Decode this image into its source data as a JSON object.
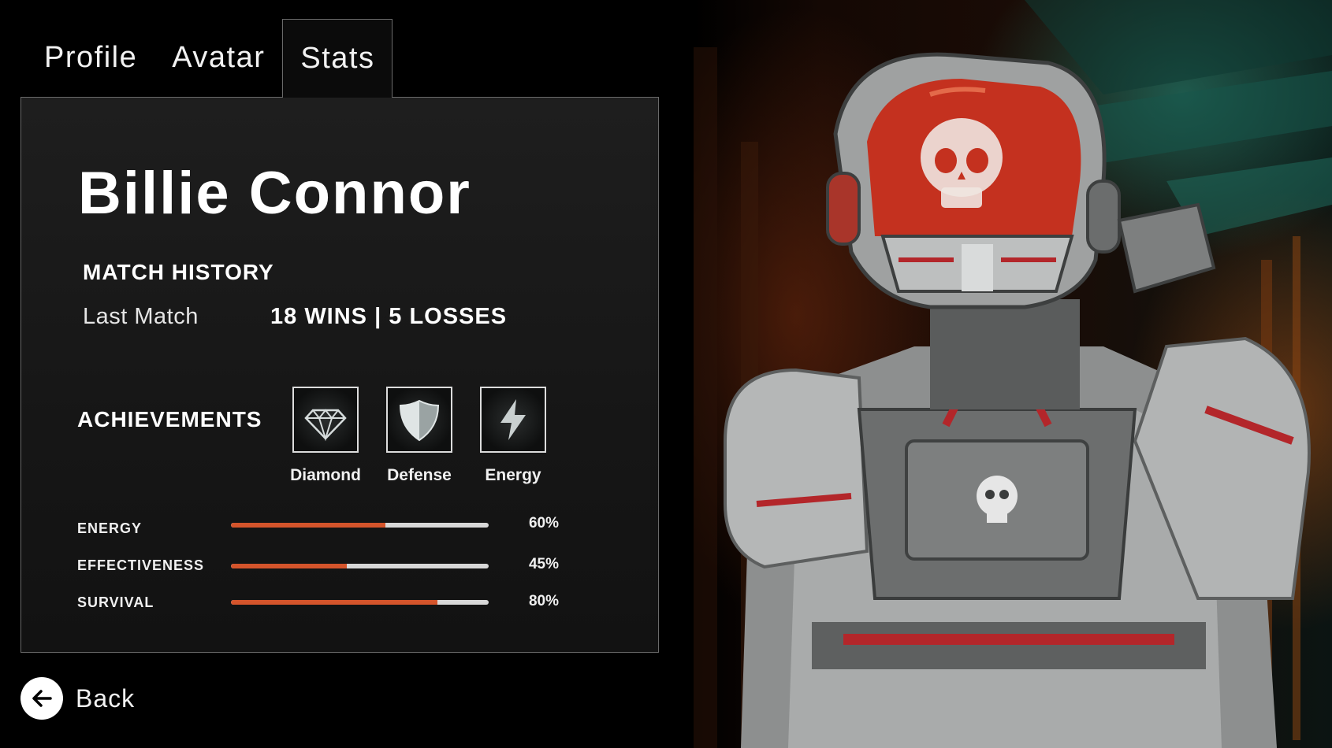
{
  "tabs": [
    {
      "label": "Profile",
      "active": false
    },
    {
      "label": "Avatar",
      "active": false
    },
    {
      "label": "Stats",
      "active": true
    }
  ],
  "player": {
    "name": "Billie Connor"
  },
  "match_history": {
    "title": "MATCH HISTORY",
    "last_match_label": "Last Match",
    "last_match_value": "18 WINS | 5 LOSSES"
  },
  "achievements": {
    "title": "ACHIEVEMENTS",
    "items": [
      {
        "label": "Diamond",
        "icon": "diamond-icon"
      },
      {
        "label": "Defense",
        "icon": "shield-icon"
      },
      {
        "label": "Energy",
        "icon": "lightning-icon"
      }
    ]
  },
  "stats": [
    {
      "label": "ENERGY",
      "value_text": "60%",
      "value": 0.6
    },
    {
      "label": "EFFECTIVENESS",
      "value_text": "45%",
      "value": 0.45
    },
    {
      "label": "SURVIVAL",
      "value_text": "80%",
      "value": 0.8
    }
  ],
  "back": {
    "label": "Back",
    "icon": "arrow-left-icon"
  },
  "colors": {
    "accent": "#d4542b",
    "track": "#d8d8d8",
    "panel_border": "#6a6a6a"
  }
}
